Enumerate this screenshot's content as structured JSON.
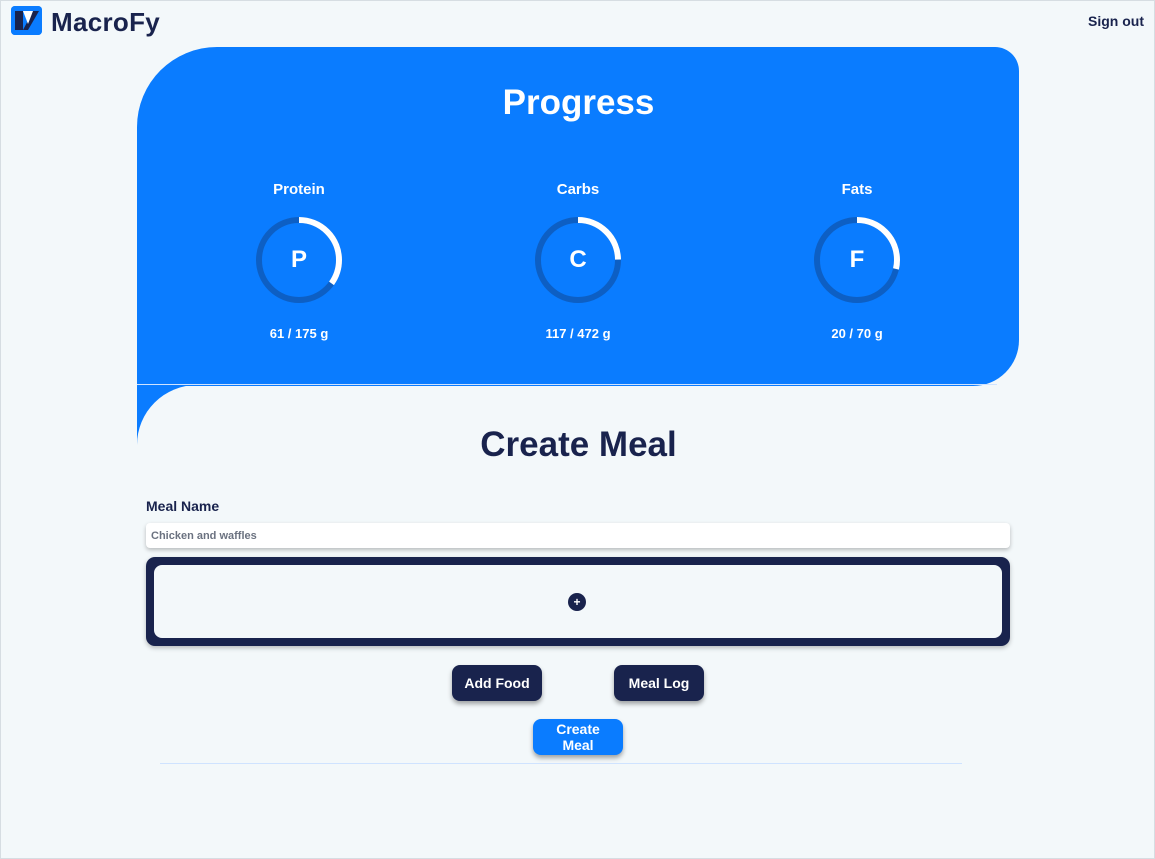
{
  "app": {
    "name": "MacroFy"
  },
  "header": {
    "signout_label": "Sign out"
  },
  "progress": {
    "title": "Progress",
    "macros": [
      {
        "label": "Protein",
        "letter": "P",
        "current": 61,
        "goal": 175,
        "unit": "g",
        "amount_text": "61 / 175 g"
      },
      {
        "label": "Carbs",
        "letter": "C",
        "current": 117,
        "goal": 472,
        "unit": "g",
        "amount_text": "117 / 472 g"
      },
      {
        "label": "Fats",
        "letter": "F",
        "current": 20,
        "goal": 70,
        "unit": "g",
        "amount_text": "20 / 70 g"
      }
    ]
  },
  "create_meal": {
    "title": "Create Meal",
    "meal_name_label": "Meal Name",
    "meal_name_placeholder": "Chicken and waffles",
    "add_item_glyph": "+",
    "add_food_label": "Add Food",
    "meal_log_label": "Meal Log",
    "create_meal_label": "Create Meal"
  },
  "icons": {
    "logo": "macrofy-logo-icon",
    "add": "plus-circle-icon"
  },
  "colors": {
    "accent": "#0a7cff",
    "dark": "#19234d",
    "background": "#f3f8fa",
    "ring_track": "#0d5fc4",
    "ring_progress": "#ffffff"
  }
}
